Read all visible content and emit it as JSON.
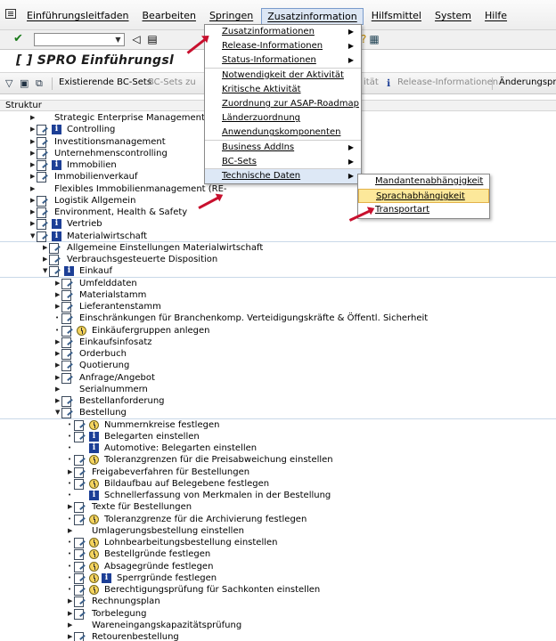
{
  "menubar": {
    "items": [
      "Einführungsleitfaden",
      "Bearbeiten",
      "Springen",
      "Zusatzinformation",
      "Hilfsmittel",
      "System",
      "Hilfe"
    ]
  },
  "title": "[ ] SPRO Einführungsl",
  "apptoolbar": {
    "existing_bc_sets": "Existierende BC-Sets",
    "bc_sets_dim": "BC-Sets zu",
    "aet": "ität",
    "release_info": "Release-Informationen",
    "change_log": "Änderungsprot"
  },
  "structure_header": "Struktur",
  "tree": [
    {
      "label": "Strategic Enterprise Management/Bus",
      "tri": "right",
      "icon": "none",
      "level": 0
    },
    {
      "label": "Controlling",
      "tri": "right",
      "icon": "doc-info",
      "level": 0
    },
    {
      "label": "Investitionsmanagement",
      "tri": "right",
      "icon": "doc",
      "level": 0
    },
    {
      "label": "Unternehmenscontrolling",
      "tri": "right",
      "icon": "doc",
      "level": 0
    },
    {
      "label": "Immobilien",
      "tri": "right",
      "icon": "doc-info",
      "level": 0
    },
    {
      "label": "Immobilienverkauf",
      "tri": "right",
      "icon": "doc",
      "level": 0
    },
    {
      "label": "Flexibles Immobilienmanagement (RE-",
      "tri": "right",
      "icon": "none",
      "level": 0
    },
    {
      "label": "Logistik Allgemein",
      "tri": "right",
      "icon": "doc",
      "level": 0
    },
    {
      "label": "Environment, Health & Safety",
      "tri": "right",
      "icon": "doc",
      "level": 0
    },
    {
      "label": "Vertrieb",
      "tri": "right",
      "icon": "doc-info",
      "level": 0
    },
    {
      "label": "Materialwirtschaft",
      "tri": "down",
      "icon": "doc-info",
      "level": 0,
      "section": true
    },
    {
      "label": "Allgemeine Einstellungen Materialwirtschaft",
      "tri": "right",
      "icon": "doc",
      "level": 1
    },
    {
      "label": "Verbrauchsgesteuerte Disposition",
      "tri": "right",
      "icon": "doc",
      "level": 1
    },
    {
      "label": "Einkauf",
      "tri": "down",
      "icon": "doc-info",
      "level": 1,
      "section": true
    },
    {
      "label": "Umfelddaten",
      "tri": "right",
      "icon": "doc",
      "level": 2
    },
    {
      "label": "Materialstamm",
      "tri": "right",
      "icon": "doc",
      "level": 2
    },
    {
      "label": "Lieferantenstamm",
      "tri": "right",
      "icon": "doc",
      "level": 2
    },
    {
      "label": "Einschränkungen für Branchenkomp. Verteidigungskräfte & Öffentl. Sicherheit",
      "tri": "dot",
      "icon": "doc",
      "level": 2
    },
    {
      "label": "Einkäufergruppen anlegen",
      "tri": "dot",
      "icon": "doc-clock",
      "level": 2
    },
    {
      "label": "Einkaufsinfosatz",
      "tri": "right",
      "icon": "doc",
      "level": 2
    },
    {
      "label": "Orderbuch",
      "tri": "right",
      "icon": "doc",
      "level": 2
    },
    {
      "label": "Quotierung",
      "tri": "right",
      "icon": "doc",
      "level": 2
    },
    {
      "label": "Anfrage/Angebot",
      "tri": "right",
      "icon": "doc",
      "level": 2
    },
    {
      "label": "Serialnummern",
      "tri": "right",
      "icon": "none",
      "level": 2
    },
    {
      "label": "Bestellanforderung",
      "tri": "right",
      "icon": "doc",
      "level": 2
    },
    {
      "label": "Bestellung",
      "tri": "down",
      "icon": "doc",
      "level": 2,
      "section": true
    },
    {
      "label": "Nummernkreise festlegen",
      "tri": "dot",
      "icon": "doc-clock",
      "level": 3
    },
    {
      "label": "Belegarten einstellen",
      "tri": "dot",
      "icon": "doc-info",
      "level": 3
    },
    {
      "label": "Automotive: Belegarten einstellen",
      "tri": "dot",
      "icon": "info-only",
      "level": 3
    },
    {
      "label": "Toleranzgrenzen für die Preisabweichung einstellen",
      "tri": "dot",
      "icon": "doc-clock",
      "level": 3
    },
    {
      "label": "Freigabeverfahren für Bestellungen",
      "tri": "right",
      "icon": "doc",
      "level": 3
    },
    {
      "label": "Bildaufbau auf Belegebene festlegen",
      "tri": "dot",
      "icon": "doc-clock",
      "level": 3
    },
    {
      "label": "Schnellerfassung von Merkmalen in der Bestellung",
      "tri": "dot",
      "icon": "info-only",
      "level": 3
    },
    {
      "label": "Texte für Bestellungen",
      "tri": "right",
      "icon": "doc",
      "level": 3
    },
    {
      "label": "Toleranzgrenze für die Archivierung festlegen",
      "tri": "dot",
      "icon": "doc-clock",
      "level": 3
    },
    {
      "label": "Umlagerungsbestellung einstellen",
      "tri": "right",
      "icon": "none",
      "level": 3
    },
    {
      "label": "Lohnbearbeitungsbestellung einstellen",
      "tri": "dot",
      "icon": "doc-clock",
      "level": 3
    },
    {
      "label": "Bestellgründe festlegen",
      "tri": "dot",
      "icon": "doc-clock",
      "level": 3
    },
    {
      "label": "Absagegründe festlegen",
      "tri": "dot",
      "icon": "doc-clock",
      "level": 3
    },
    {
      "label": "Sperrgründe festlegen",
      "tri": "dot",
      "icon": "doc-clock-info",
      "level": 3
    },
    {
      "label": "Berechtigungsprüfung für Sachkonten einstellen",
      "tri": "dot",
      "icon": "doc-clock",
      "level": 3
    },
    {
      "label": "Rechnungsplan",
      "tri": "right",
      "icon": "doc",
      "level": 3
    },
    {
      "label": "Torbelegung",
      "tri": "right",
      "icon": "doc",
      "level": 3
    },
    {
      "label": "Wareneingangskapazitätsprüfung",
      "tri": "right",
      "icon": "none",
      "level": 3
    },
    {
      "label": "Retourenbestellung",
      "tri": "right",
      "icon": "doc",
      "level": 3
    }
  ],
  "dropdown_main": {
    "items": [
      {
        "label": "Zusatzinformationen",
        "arrow": true,
        "sep": false
      },
      {
        "label": "Release-Informationen",
        "arrow": true,
        "sep": false
      },
      {
        "label": "Status-Informationen",
        "arrow": true,
        "sep": true
      },
      {
        "label": "Notwendigkeit der Aktivität",
        "arrow": false,
        "sep": false
      },
      {
        "label": "Kritische Aktivität",
        "arrow": false,
        "sep": false
      },
      {
        "label": "Zuordnung zur ASAP-Roadmap",
        "arrow": false,
        "sep": false
      },
      {
        "label": "Länderzuordnung",
        "arrow": false,
        "sep": false
      },
      {
        "label": "Anwendungskomponenten",
        "arrow": false,
        "sep": true
      },
      {
        "label": "Business AddIns",
        "arrow": true,
        "sep": false
      },
      {
        "label": "BC-Sets",
        "arrow": true,
        "sep": true
      },
      {
        "label": "Technische Daten",
        "arrow": true,
        "sep": false,
        "active": true
      }
    ]
  },
  "dropdown_sub": {
    "items": [
      {
        "label": "Mandantenabhängigkeit"
      },
      {
        "label": "Sprachabhängigkeit",
        "highlight": true
      },
      {
        "label": "Transportart"
      }
    ]
  }
}
